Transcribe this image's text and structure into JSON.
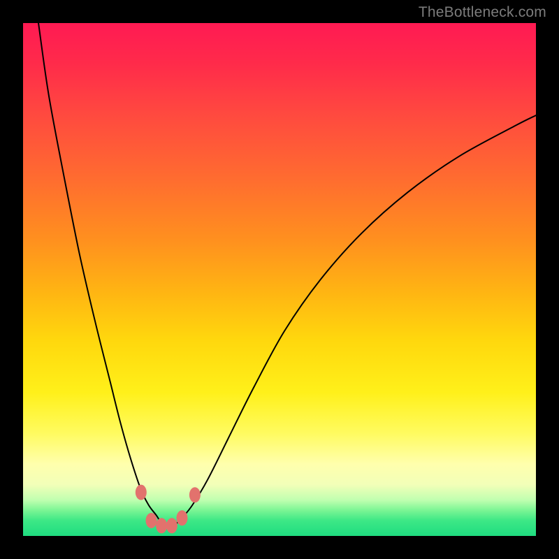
{
  "watermark": {
    "text": "TheBottleneck.com"
  },
  "chart_data": {
    "type": "line",
    "title": "",
    "xlabel": "",
    "ylabel": "",
    "xlim": [
      0,
      100
    ],
    "ylim": [
      0,
      100
    ],
    "series": [
      {
        "name": "bottleneck-curve",
        "x": [
          3,
          5,
          8,
          11,
          14,
          17,
          19,
          21,
          23,
          24.5,
          26,
          27,
          28,
          29,
          30,
          31,
          33,
          36,
          40,
          45,
          51,
          58,
          66,
          75,
          85,
          96,
          100
        ],
        "y": [
          100,
          86,
          70,
          55,
          42,
          30,
          22,
          15,
          9,
          6,
          4,
          2.5,
          2,
          2,
          2.5,
          3.5,
          6,
          11,
          19,
          29,
          40,
          50,
          59,
          67,
          74,
          80,
          82
        ]
      }
    ],
    "markers": [
      {
        "name": "dot-left-upper",
        "x": 23.0,
        "y": 8.5
      },
      {
        "name": "dot-left-mid",
        "x": 25.0,
        "y": 3.0
      },
      {
        "name": "dot-bottom-1",
        "x": 27.0,
        "y": 2.0
      },
      {
        "name": "dot-bottom-2",
        "x": 29.0,
        "y": 2.0
      },
      {
        "name": "dot-right-mid",
        "x": 31.0,
        "y": 3.5
      },
      {
        "name": "dot-right-upper",
        "x": 33.5,
        "y": 8.0
      }
    ],
    "colors": {
      "curve": "#000000",
      "marker": "#e2726d"
    }
  }
}
